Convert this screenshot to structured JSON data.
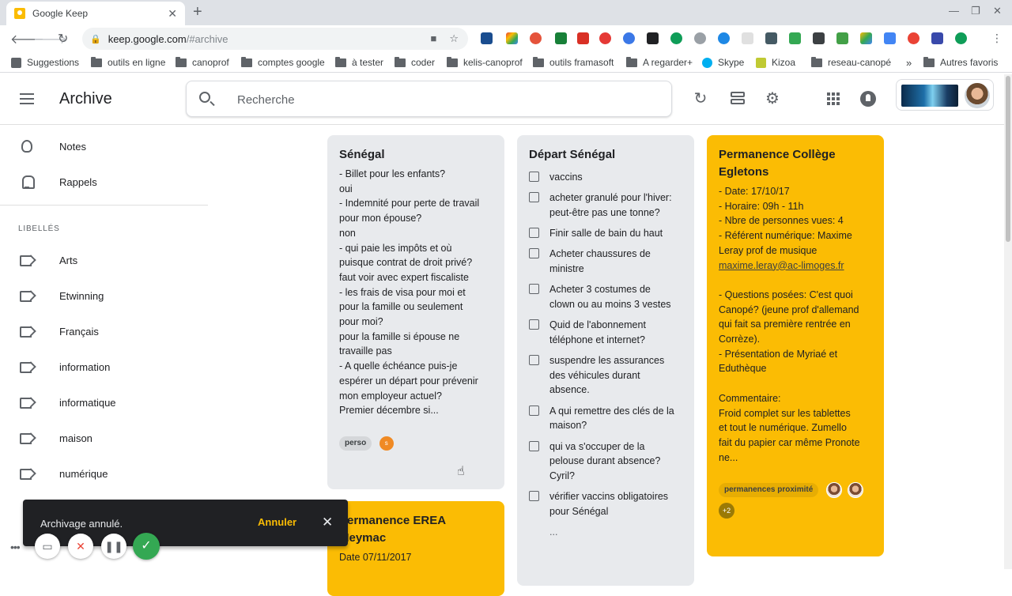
{
  "browser": {
    "tab_title": "Google Keep",
    "tab_close": "✕",
    "new_tab": "+",
    "window_controls": [
      "—",
      "❐",
      "✕"
    ],
    "url_host": "keep.google.com",
    "url_path": "/#archive",
    "bookmarks": [
      {
        "label": "Suggestions",
        "icon": "grid-icon"
      },
      {
        "label": "outils en ligne",
        "icon": "folder-icon"
      },
      {
        "label": "canoprof",
        "icon": "folder-icon"
      },
      {
        "label": "comptes google",
        "icon": "folder-icon"
      },
      {
        "label": "à tester",
        "icon": "folder-icon"
      },
      {
        "label": "coder",
        "icon": "folder-icon"
      },
      {
        "label": "kelis-canoprof",
        "icon": "folder-icon"
      },
      {
        "label": "outils framasoft",
        "icon": "folder-icon"
      },
      {
        "label": "A regarder+",
        "icon": "folder-icon"
      },
      {
        "label": "Skype",
        "icon": "skype-icon"
      },
      {
        "label": "Kizoa",
        "icon": "kizoa-icon"
      },
      {
        "label": "reseau-canopé",
        "icon": "folder-icon"
      }
    ],
    "bookmarks_overflow": "»",
    "other_bookmarks": "Autres favoris"
  },
  "header": {
    "title": "Archive",
    "search_placeholder": "Recherche"
  },
  "sidebar": {
    "top_items": [
      {
        "label": "Notes",
        "icon": "lightbulb-icon"
      },
      {
        "label": "Rappels",
        "icon": "bell-icon"
      }
    ],
    "labels_heading": "LIBELLÉS",
    "labels": [
      "Arts",
      "Etwinning",
      "Français",
      "information",
      "informatique",
      "maison",
      "numérique"
    ]
  },
  "notes": {
    "senegal": {
      "title": "Sénégal",
      "lines": [
        "- Billet pour les enfants?",
        "oui",
        "- Indemnité pour perte de travail",
        "pour mon épouse?",
        "non",
        "- qui paie les impôts et où",
        "puisque contrat de droit privé?",
        "faut voir avec expert fiscaliste",
        "- les frais de visa pour moi et",
        "pour la famille ou seulement",
        "pour moi?",
        "pour la famille si épouse ne",
        "travaille pas",
        "- A quelle échéance puis-je",
        "espérer un départ pour prévenir",
        "mon employeur actuel?",
        "Premier décembre si..."
      ],
      "label": "perso",
      "collaborator_initial": "s"
    },
    "depart": {
      "title": "Départ Sénégal",
      "items": [
        [
          "vaccins"
        ],
        [
          "acheter granulé pour l'hiver:",
          "peut-être pas une tonne?"
        ],
        [
          "Finir salle de bain du haut"
        ],
        [
          "Acheter chaussures de",
          "ministre"
        ],
        [
          "Acheter 3 costumes de",
          "clown ou au moins 3 vestes"
        ],
        [
          "Quid de l'abonnement",
          "téléphone et internet?"
        ],
        [
          "suspendre les assurances",
          "des véhicules durant",
          "absence."
        ],
        [
          "A qui remettre des clés de la",
          "maison?"
        ],
        [
          "qui va s'occuper de la",
          "pelouse durant absence?",
          "Cyril?"
        ],
        [
          "vérifier vaccins obligatoires",
          "pour Sénégal"
        ]
      ],
      "more": "..."
    },
    "permanence_egletons": {
      "title_lines": [
        "Permanence Collège",
        "Egletons"
      ],
      "lines": [
        "- Date: 17/10/17",
        "- Horaire: 09h - 11h",
        "- Nbre de personnes vues: 4",
        "- Référent numérique: Maxime",
        "Leray prof de musique"
      ],
      "email": "maxime.leray@ac-limoges.fr",
      "lines2": [
        "",
        "- Questions posées: C'est quoi",
        "Canopé? (jeune prof d'allemand",
        "qui fait sa première rentrée en",
        "Corrèze).",
        "- Présentation de Myriaé et",
        "Eduthèque",
        "",
        "Commentaire:",
        "Froid complet sur les tablettes",
        "et tout le numérique. Zumello",
        "fait du papier car même Pronote",
        "ne..."
      ],
      "label": "permanences proximité",
      "more_collaborators": "+2"
    },
    "permanence_erea": {
      "title_lines": [
        "Permanence EREA",
        "Meymac"
      ],
      "lines": [
        "Date 07/11/2017"
      ]
    }
  },
  "snackbar": {
    "message": "Archivage annulé.",
    "action": "Annuler",
    "close": "✕"
  },
  "colors": {
    "yellow_note": "#fbbc04",
    "grey_note": "#e8eaed",
    "snackbar_bg": "#202124",
    "snackbar_action": "#fbbc04"
  }
}
